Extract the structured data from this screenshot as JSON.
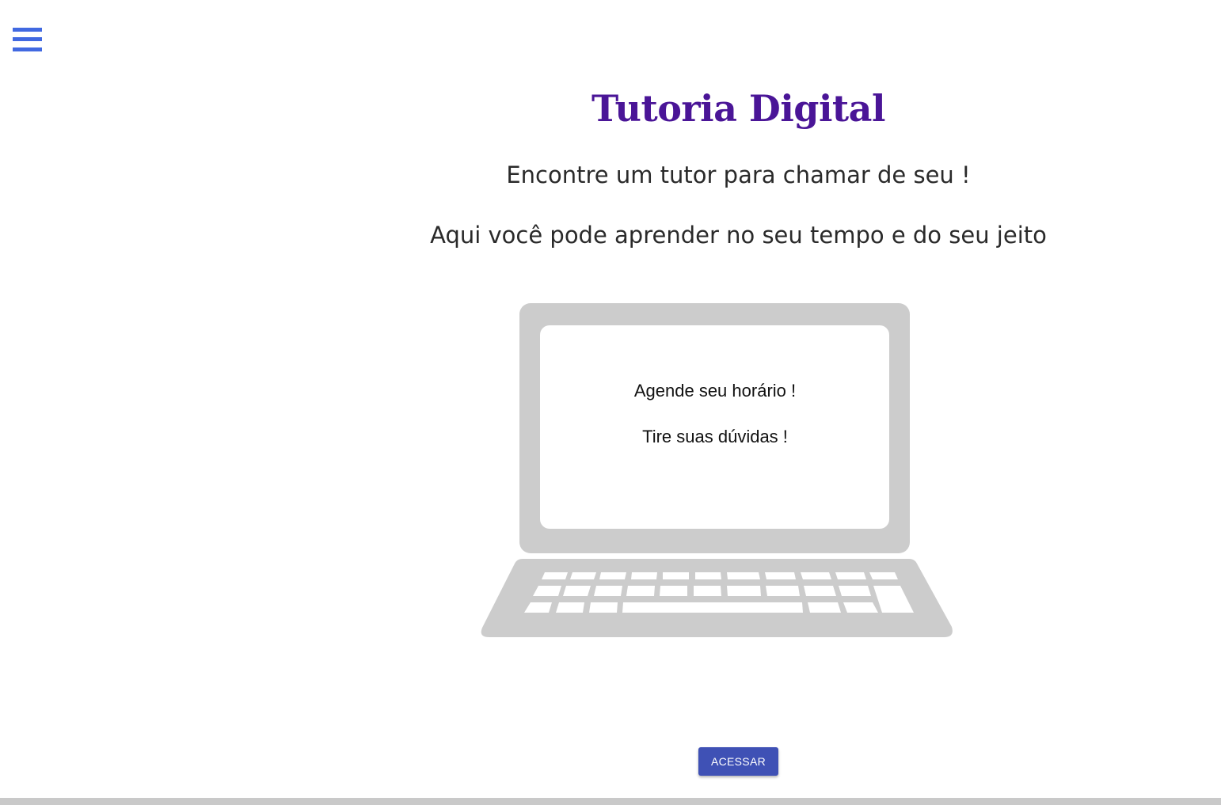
{
  "header": {
    "menu_icon": "hamburger-menu-icon"
  },
  "main": {
    "title": "Tutoria Digital",
    "subtitle_1": "Encontre um tutor para chamar de seu !",
    "subtitle_2": "Aqui você pode aprender no seu tempo e do seu jeito"
  },
  "illustration": {
    "icon": "laptop-illustration",
    "screen_line_1": "Agende seu horário !",
    "screen_line_2": "Tire suas dúvidas !"
  },
  "actions": {
    "access_label": "ACESSAR"
  },
  "colors": {
    "menu_icon": "#4169e1",
    "title": "#4a1597",
    "button": "#3f51b5",
    "laptop": "#cccccc",
    "footer": "#c9c9c9"
  }
}
